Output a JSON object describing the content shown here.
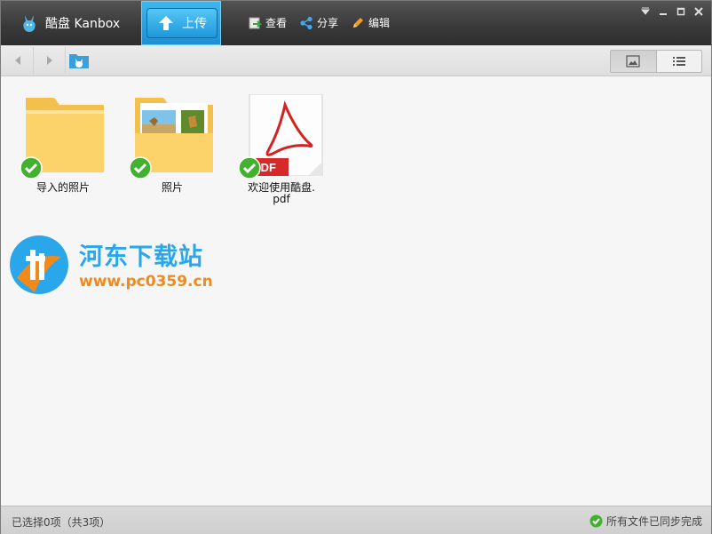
{
  "app": {
    "brand": "酷盘 Kanbox",
    "upload_label": "上传",
    "actions": [
      {
        "label": "查看",
        "icon": "view-icon"
      },
      {
        "label": "分享",
        "icon": "share-icon"
      },
      {
        "label": "编辑",
        "icon": "edit-icon"
      }
    ]
  },
  "files": [
    {
      "name": "导入的照片",
      "type": "folder",
      "synced": true
    },
    {
      "name": "照片",
      "type": "photo-folder",
      "synced": true
    },
    {
      "name": "欢迎使用酷盘.pdf",
      "name_line1": "欢迎使用酷盘.",
      "name_line2": "pdf",
      "type": "pdf",
      "synced": true
    }
  ],
  "watermark": {
    "title": "河东下载站",
    "url": "www.pc0359.cn"
  },
  "status": {
    "selection": "已选择0项（共3项）",
    "sync": "所有文件已同步完成"
  },
  "colors": {
    "accent": "#1a8fd4",
    "sync_green": "#3cb02c",
    "watermark_blue": "#2aa7ea",
    "watermark_orange": "#f08a1c"
  }
}
